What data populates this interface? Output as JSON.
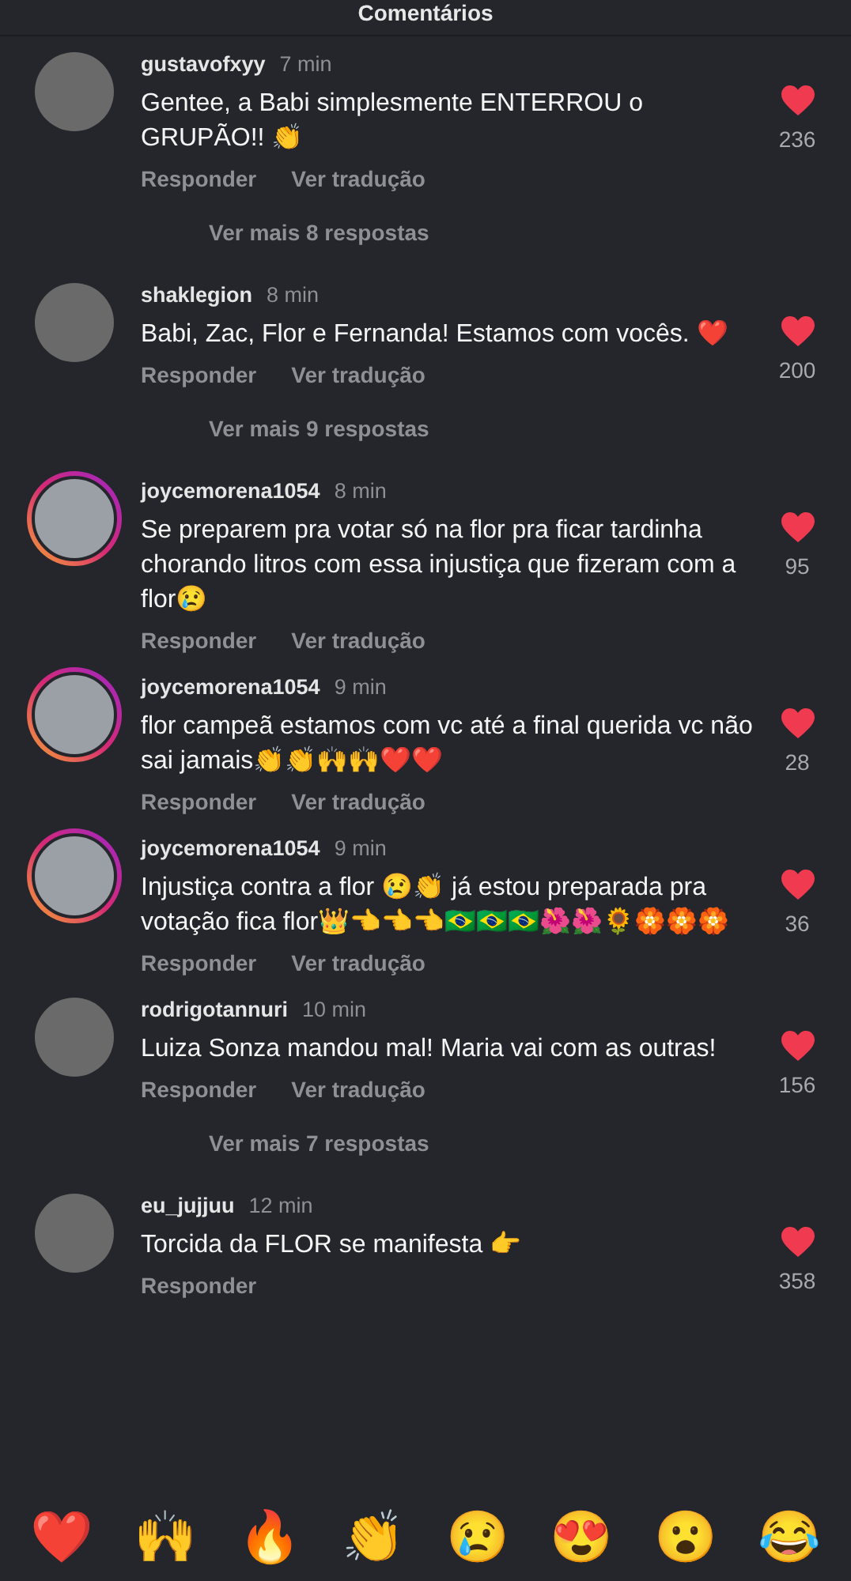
{
  "header": {
    "title": "Comentários"
  },
  "comments": [
    {
      "username": "gustavofxyy",
      "time": "7 min",
      "text": "Gentee, a Babi simplesmente ENTERROU o GRUPÃO!! 👏",
      "likes": "236",
      "liked": true,
      "story_ring": false,
      "actions": [
        "Responder",
        "Ver tradução"
      ],
      "more_replies": "Ver mais 8 respostas"
    },
    {
      "username": "shaklegion",
      "time": "8 min",
      "text": "Babi, Zac, Flor e Fernanda! Estamos com vocês. ❤️",
      "likes": "200",
      "liked": true,
      "story_ring": false,
      "actions": [
        "Responder",
        "Ver tradução"
      ],
      "more_replies": "Ver mais 9 respostas"
    },
    {
      "username": "joycemorena1054",
      "time": "8 min",
      "text": "Se preparem pra votar só na flor pra ficar tardinha chorando litros com essa injustiça que fizeram com a flor😢",
      "likes": "95",
      "liked": true,
      "story_ring": true,
      "actions": [
        "Responder",
        "Ver tradução"
      ]
    },
    {
      "username": "joycemorena1054",
      "time": "9 min",
      "text": "flor campeã estamos com vc até a final querida vc não sai jamais👏👏🙌🙌❤️❤️",
      "likes": "28",
      "liked": true,
      "story_ring": true,
      "actions": [
        "Responder",
        "Ver tradução"
      ]
    },
    {
      "username": "joycemorena1054",
      "time": "9 min",
      "text": "Injustiça contra a flor 😢👏 já estou preparada pra votação fica flor👑👈👈👈🇧🇷🇧🇷🇧🇷🌺🌺🌻🏵️🏵️🏵️",
      "likes": "36",
      "liked": true,
      "story_ring": true,
      "actions": [
        "Responder",
        "Ver tradução"
      ]
    },
    {
      "username": "rodrigotannuri",
      "time": "10 min",
      "text": "Luiza Sonza mandou mal! Maria vai com as outras!",
      "likes": "156",
      "liked": true,
      "story_ring": false,
      "actions": [
        "Responder",
        "Ver tradução"
      ],
      "more_replies": "Ver mais 7 respostas"
    },
    {
      "username": "eu_jujjuu",
      "time": "12 min",
      "text": "Torcida da FLOR se manifesta 👉",
      "likes": "358",
      "liked": true,
      "story_ring": false,
      "actions": [
        "Responder"
      ]
    }
  ],
  "reactions": [
    "❤️",
    "🙌",
    "🔥",
    "👏",
    "😢",
    "😍",
    "😮",
    "😂"
  ]
}
